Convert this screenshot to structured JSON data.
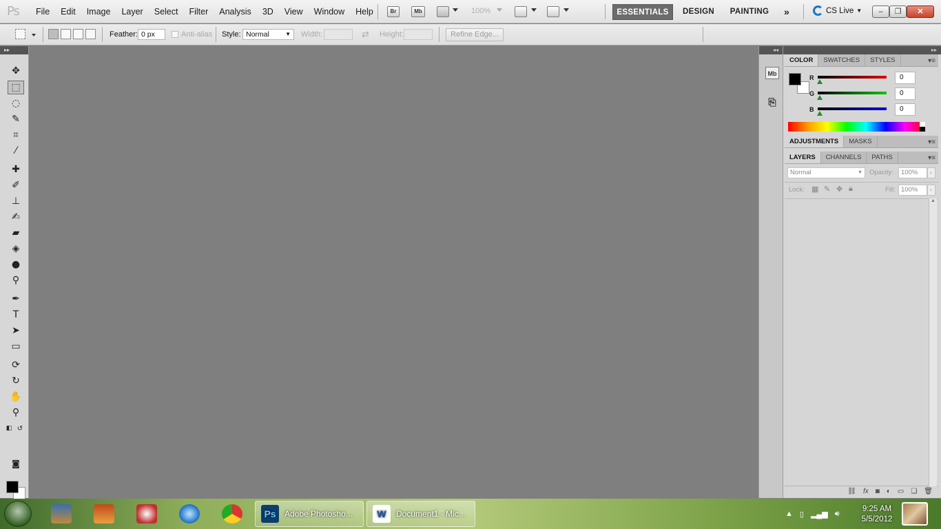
{
  "app": {
    "logo": "Ps"
  },
  "menus": [
    "File",
    "Edit",
    "Image",
    "Layer",
    "Select",
    "Filter",
    "Analysis",
    "3D",
    "View",
    "Window",
    "Help"
  ],
  "menubar": {
    "bridge": "Br",
    "minibridge": "Mb",
    "zoom": "100%",
    "workspaces": [
      "ESSENTIALS",
      "DESIGN",
      "PAINTING"
    ],
    "more": "»",
    "cs_live": "CS Live"
  },
  "options": {
    "feather_label": "Feather:",
    "feather_value": "0 px",
    "anti_alias_label": "Anti-alias",
    "style_label": "Style:",
    "style_value": "Normal",
    "width_label": "Width:",
    "height_label": "Height:",
    "refine_label": "Refine Edge..."
  },
  "color_panel": {
    "tabs": [
      "COLOR",
      "SWATCHES",
      "STYLES"
    ],
    "channels": [
      {
        "label": "R",
        "value": "0",
        "color": "#d40000"
      },
      {
        "label": "G",
        "value": "0",
        "color": "#00b000"
      },
      {
        "label": "B",
        "value": "0",
        "color": "#0000c8"
      }
    ],
    "foreground": "#000000",
    "background": "#ffffff"
  },
  "adjust_panel": {
    "tabs": [
      "ADJUSTMENTS",
      "MASKS"
    ]
  },
  "layers_panel": {
    "tabs": [
      "LAYERS",
      "CHANNELS",
      "PATHS"
    ],
    "blend_mode": "Normal",
    "opacity_label": "Opacity:",
    "opacity_value": "100%",
    "lock_label": "Lock:",
    "fill_label": "Fill:",
    "fill_value": "100%"
  },
  "dock": {
    "minibridge": "Mb"
  },
  "taskbar": {
    "tasks": [
      {
        "label": "Adobe Photosho...",
        "logo": "Ps"
      },
      {
        "label": "Document1 - Mic...",
        "logo": "W"
      }
    ],
    "time": "9:25 AM",
    "date": "5/5/2012"
  }
}
